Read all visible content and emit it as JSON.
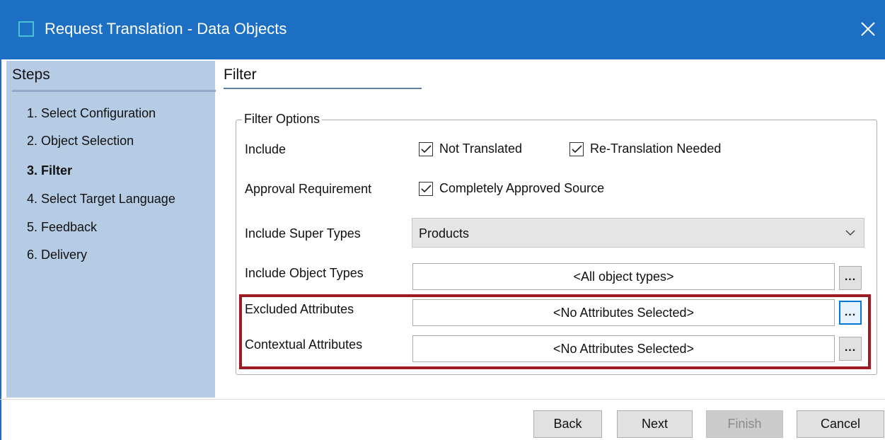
{
  "window": {
    "title": "Request Translation - Data Objects",
    "close_glyph": "✕",
    "accent_color": "#1c6fc2"
  },
  "steps": {
    "heading": "Steps",
    "items": [
      {
        "label": "1. Select Configuration",
        "active": false
      },
      {
        "label": "2. Object Selection",
        "active": false
      },
      {
        "label": "3. Filter",
        "active": true
      },
      {
        "label": "4. Select Target Language",
        "active": false
      },
      {
        "label": "5. Feedback",
        "active": false
      },
      {
        "label": "6. Delivery",
        "active": false
      }
    ]
  },
  "main": {
    "heading": "Filter",
    "group_title": "Filter Options",
    "include": {
      "label": "Include",
      "not_translated": {
        "label": "Not Translated",
        "checked": true
      },
      "retranslation": {
        "label": "Re-Translation Needed",
        "checked": true
      }
    },
    "approval": {
      "label": "Approval Requirement",
      "completely_approved": {
        "label": "Completely Approved Source",
        "checked": true
      }
    },
    "super_types": {
      "label": "Include Super Types",
      "value": "Products"
    },
    "object_types": {
      "label": "Include Object Types",
      "value": "<All object types>",
      "browse_label": "..."
    },
    "excluded_attributes": {
      "label": "Excluded Attributes",
      "value": "<No Attributes Selected>",
      "browse_label": "..."
    },
    "contextual_attributes": {
      "label": "Contextual Attributes",
      "value": "<No Attributes Selected>",
      "browse_label": "..."
    },
    "highlight_color": "#9d1b22"
  },
  "footer": {
    "back": "Back",
    "next": "Next",
    "finish": "Finish",
    "finish_enabled": false,
    "cancel": "Cancel"
  }
}
